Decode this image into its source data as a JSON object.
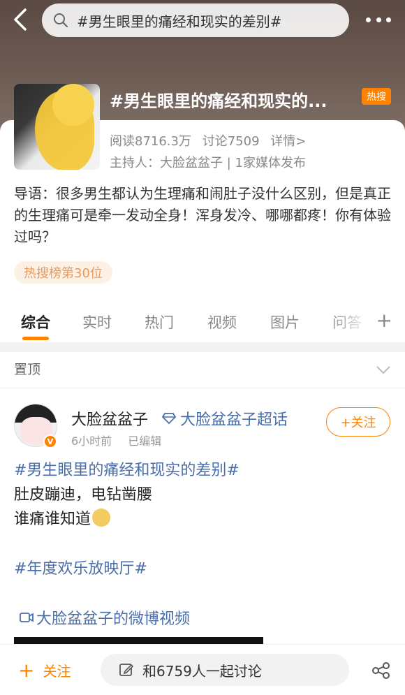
{
  "header": {
    "search_text": "#男生眼里的痛经和现实的差别#"
  },
  "topic": {
    "title": "#男生眼里的痛经和现实的...",
    "hot_badge": "热搜",
    "reads": "阅读8716.3万",
    "discussions": "讨论7509",
    "details": "详情>",
    "host": "主持人：大脸盆盆子 | 1家媒体发布",
    "intro": "导语：很多男生都认为生理痛和闹肚子没什么区别，但是真正的生理痛可是牵一发动全身！浑身发冷、哪哪都疼！你有体验过吗？",
    "rank": "热搜榜第30位"
  },
  "tabs": [
    {
      "label": "综合"
    },
    {
      "label": "实时"
    },
    {
      "label": "热门"
    },
    {
      "label": "视频"
    },
    {
      "label": "图片"
    },
    {
      "label": "问答"
    }
  ],
  "pinned": {
    "label": "置顶"
  },
  "post": {
    "author": "大脸盆盆子",
    "super_topic": "大脸盆盆子超话",
    "time": "6小时前",
    "edited": "已编辑",
    "follow": "+关注",
    "tag": "#男生眼里的痛经和现实的差别#",
    "line1": "肚皮蹦迪，电钻凿腰",
    "line2": "谁痛谁知道",
    "tag2": "#年度欢乐放映厅#",
    "video_link": "大脸盆盆子的微博视频"
  },
  "bottom": {
    "follow": "关注",
    "follow_plus": "+",
    "discuss": "和6759人一起讨论"
  },
  "colors": {
    "accent": "#ff8200",
    "link": "#4a6ea9"
  }
}
